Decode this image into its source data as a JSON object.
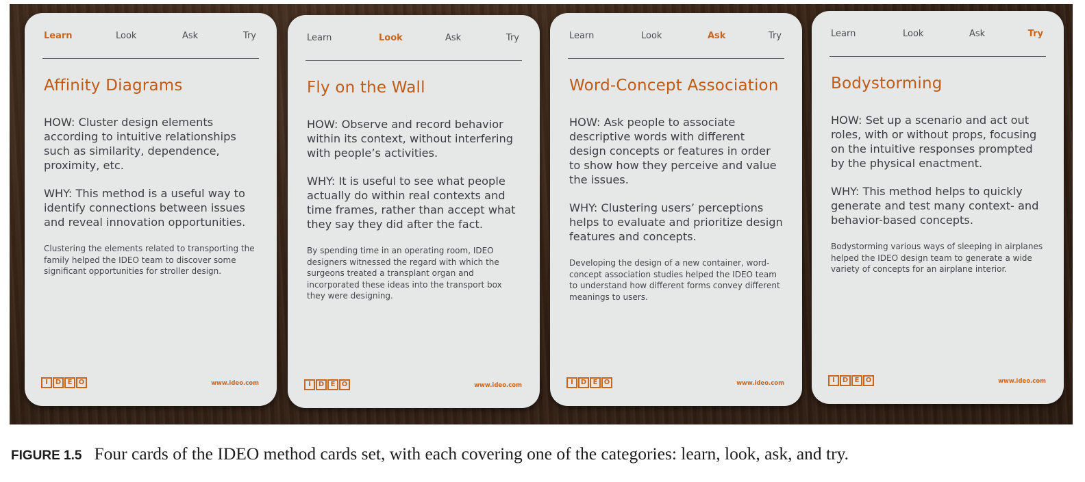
{
  "tab_labels": [
    "Learn",
    "Look",
    "Ask",
    "Try"
  ],
  "cards": [
    {
      "active_tab": 0,
      "title": "Affinity Diagrams",
      "how": "HOW: Cluster design elements according to intuitive relationships such as similarity, dependence, proximity, etc.",
      "why": "WHY: This method is a useful way to identify connections between issues and reveal innovation opportunities.",
      "example": "Clustering the elements related to transporting the family helped the IDEO team to discover some significant opportunities for stroller design.",
      "logo": "IDEO",
      "url": "www.ideo.com"
    },
    {
      "active_tab": 1,
      "title": "Fly on the Wall",
      "how": "HOW: Observe and record behavior within its context, without interfering with people’s activities.",
      "why": "WHY: It is useful to see what people actually do within real contexts and time frames, rather than accept what they say they did after the fact.",
      "example": "By spending time in an operating room, IDEO designers witnessed the regard with which the surgeons treated a transplant organ and incorporated these ideas into the transport box they were designing.",
      "logo": "IDEO",
      "url": "www.ideo.com"
    },
    {
      "active_tab": 2,
      "title": "Word-Concept Association",
      "how": "HOW: Ask people to associate descriptive words with different design concepts or features in order to show how they perceive and value the issues.",
      "why": "WHY: Clustering users’ perceptions helps to evaluate and prioritize design features and concepts.",
      "example": "Developing the design of a new container, word-concept association studies helped the IDEO team to understand how different forms convey different meanings to users.",
      "logo": "IDEO",
      "url": "www.ideo.com"
    },
    {
      "active_tab": 3,
      "title": "Bodystorming",
      "how": "HOW: Set up a scenario and act out roles, with or without props, focusing on the intuitive responses prompted by the physical enactment.",
      "why": "WHY: This method helps to quickly generate and test many context- and behavior-based concepts.",
      "example": "Bodystorming various ways of sleeping in airplanes helped the IDEO design team to generate a wide variety of concepts for an airplane interior.",
      "logo": "IDEO",
      "url": "www.ideo.com"
    }
  ],
  "caption": {
    "label": "FIGURE 1.5",
    "text": "Four cards of the IDEO method cards set, with each covering one of the categories: learn, look, ask, and try."
  },
  "colors": {
    "accent": "#c9661e",
    "card": "#e6e8e7",
    "table_wood": "#3a2618"
  }
}
